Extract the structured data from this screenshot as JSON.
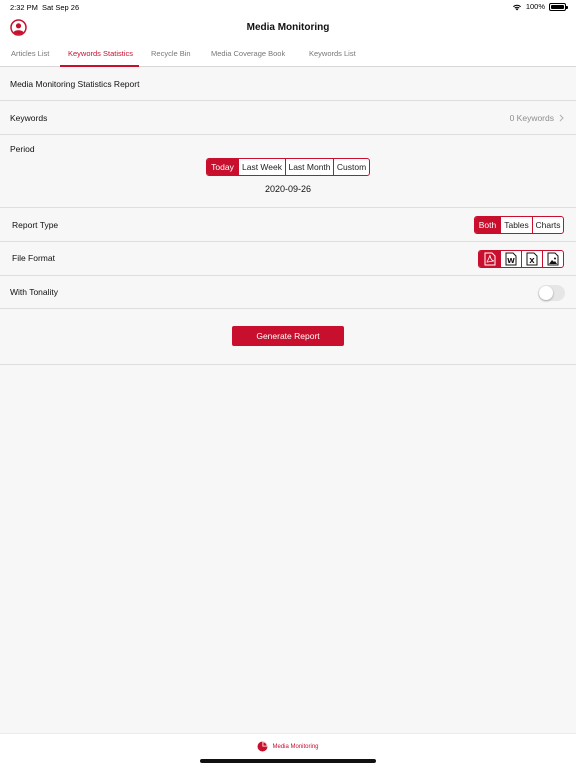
{
  "status_bar": {
    "time": "2:32 PM",
    "date": "Sat Sep 26",
    "battery": "100%"
  },
  "header": {
    "title": "Media Monitoring",
    "profile_icon": "person-circle-icon"
  },
  "tabs": [
    {
      "label": "Articles List",
      "active": false
    },
    {
      "label": "Keywords Statistics",
      "active": true
    },
    {
      "label": "Recycle Bin",
      "active": false
    },
    {
      "label": "Media Coverage Book",
      "active": false
    },
    {
      "label": "Keywords List",
      "active": false
    }
  ],
  "report": {
    "title": "Media Monitoring Statistics Report",
    "keywords": {
      "label": "Keywords",
      "value": "0 Keywords"
    },
    "period": {
      "label": "Period",
      "options": [
        "Today",
        "Last Week",
        "Last Month",
        "Custom"
      ],
      "selected": "Today",
      "date": "2020-09-26"
    },
    "report_type": {
      "label": "Report Type",
      "options": [
        "Both",
        "Tables",
        "Charts"
      ],
      "selected": "Both"
    },
    "file_format": {
      "label": "File Format",
      "options": [
        "pdf-icon",
        "word-icon",
        "excel-icon",
        "image-icon"
      ],
      "selected": "pdf-icon"
    },
    "tonality": {
      "label": "With Tonality",
      "enabled": false
    },
    "generate_button": "Generate Report"
  },
  "bottom_nav": {
    "label": "Media Monitoring",
    "icon": "pie-chart-icon"
  },
  "colors": {
    "accent": "#c8102e",
    "background": "#f7f7f7"
  }
}
